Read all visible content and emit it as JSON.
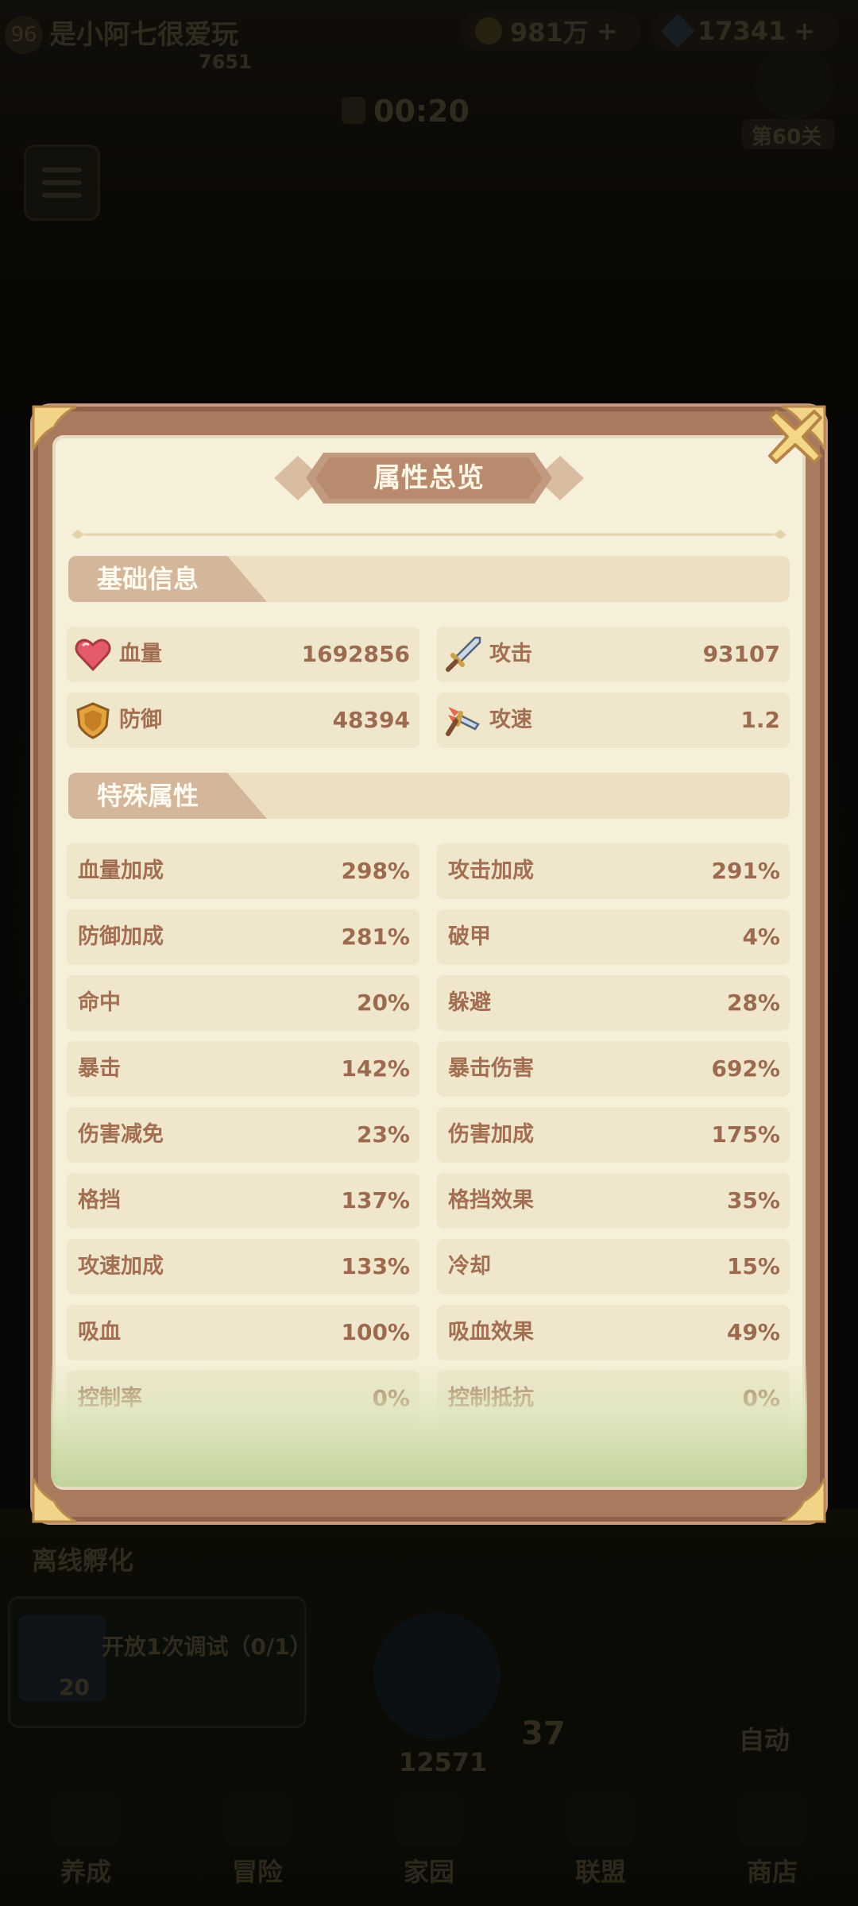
{
  "background": {
    "player_level": "96",
    "player_name": "是小阿七很爱玩",
    "player_sub": "7651",
    "gold": "981万",
    "gems": "17341",
    "timer": "00:20",
    "stage": "第60关",
    "offline_label": "离线孵化",
    "quest_text": "开放1次调试（0/1）",
    "quest_count": "20",
    "score": "12571",
    "round": "37",
    "auto_label": "自动",
    "nav": [
      "养成",
      "冒险",
      "家园",
      "联盟",
      "商店"
    ]
  },
  "modal": {
    "title": "属性总览",
    "close_icon": "close-x-icon",
    "basic": {
      "header": "基础信息",
      "stats": [
        {
          "icon": "heart-icon",
          "label": "血量",
          "value": "1692856"
        },
        {
          "icon": "sword-icon",
          "label": "攻击",
          "value": "93107"
        },
        {
          "icon": "shield-icon",
          "label": "防御",
          "value": "48394"
        },
        {
          "icon": "speed-sword-icon",
          "label": "攻速",
          "value": "1.2"
        }
      ]
    },
    "special": {
      "header": "特殊属性",
      "stats": [
        {
          "label": "血量加成",
          "value": "298%"
        },
        {
          "label": "攻击加成",
          "value": "291%"
        },
        {
          "label": "防御加成",
          "value": "281%"
        },
        {
          "label": "破甲",
          "value": "4%"
        },
        {
          "label": "命中",
          "value": "20%"
        },
        {
          "label": "躲避",
          "value": "28%"
        },
        {
          "label": "暴击",
          "value": "142%"
        },
        {
          "label": "暴击伤害",
          "value": "692%"
        },
        {
          "label": "伤害减免",
          "value": "23%"
        },
        {
          "label": "伤害加成",
          "value": "175%"
        },
        {
          "label": "格挡",
          "value": "137%"
        },
        {
          "label": "格挡效果",
          "value": "35%"
        },
        {
          "label": "攻速加成",
          "value": "133%"
        },
        {
          "label": "冷却",
          "value": "15%"
        },
        {
          "label": "吸血",
          "value": "100%"
        },
        {
          "label": "吸血效果",
          "value": "49%"
        },
        {
          "label": "控制率",
          "value": "0%"
        },
        {
          "label": "控制抵抗",
          "value": "0%"
        }
      ]
    }
  },
  "colors": {
    "frame": "#a87b5f",
    "panel": "#f6f0da",
    "row_bg": "#efe6cc",
    "label_text": "#a26f52",
    "section_tab": "#d4b79b"
  }
}
